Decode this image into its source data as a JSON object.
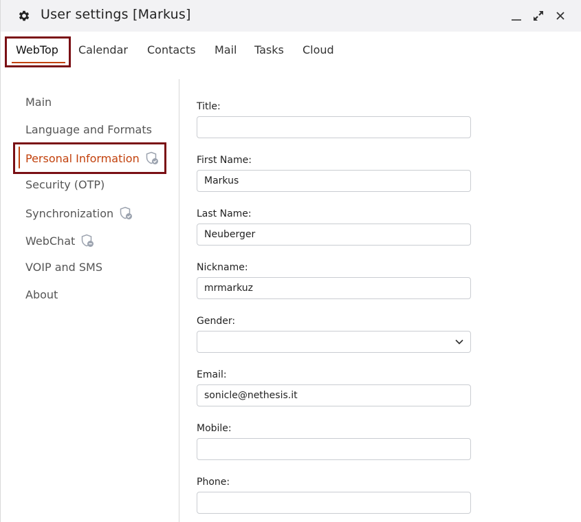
{
  "window": {
    "title": "User settings [Markus]",
    "icons": {
      "title": "gear-icon",
      "minimize": "minimize-icon",
      "maximize": "maximize-icon",
      "close": "close-icon"
    }
  },
  "tabs": [
    {
      "label": "WebTop",
      "active": true
    },
    {
      "label": "Calendar"
    },
    {
      "label": "Contacts"
    },
    {
      "label": "Mail"
    },
    {
      "label": "Tasks"
    },
    {
      "label": "Cloud"
    }
  ],
  "nav": {
    "items": [
      {
        "label": "Main"
      },
      {
        "label": "Language and Formats"
      },
      {
        "label": "Personal Information",
        "active": true,
        "badge": "shield-check-icon"
      },
      {
        "label": "Security (OTP)"
      },
      {
        "label": "Synchronization",
        "badge": "shield-check-icon"
      },
      {
        "label": "WebChat",
        "badge": "shield-minus-icon"
      },
      {
        "label": "VOIP and SMS"
      },
      {
        "label": "About"
      }
    ]
  },
  "form": {
    "title": {
      "label": "Title:",
      "value": ""
    },
    "first_name": {
      "label": "First Name:",
      "value": "Markus"
    },
    "last_name": {
      "label": "Last Name:",
      "value": "Neuberger"
    },
    "nickname": {
      "label": "Nickname:",
      "value": "mrmarkuz"
    },
    "gender": {
      "label": "Gender:",
      "value": ""
    },
    "email": {
      "label": "Email:",
      "value": "sonicle@nethesis.it"
    },
    "mobile": {
      "label": "Mobile:",
      "value": ""
    },
    "phone": {
      "label": "Phone:",
      "value": ""
    }
  },
  "colors": {
    "accent": "#c2410c",
    "highlight": "#7a0f14",
    "titlebar": "#f2f2f4"
  }
}
